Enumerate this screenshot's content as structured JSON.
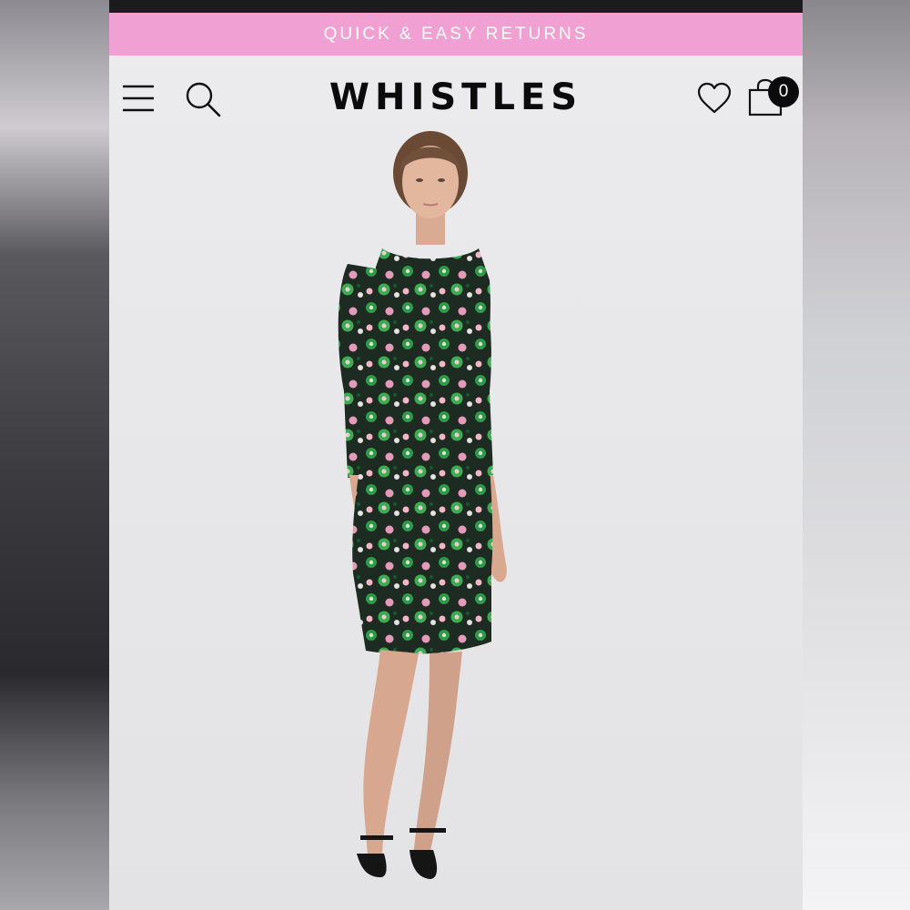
{
  "promo": {
    "text": "QUICK & EASY RETURNS"
  },
  "header": {
    "brand": "WHISTLES",
    "menu_icon": "hamburger-menu-icon",
    "search_icon": "search-icon",
    "wishlist_icon": "heart-icon",
    "bag_icon": "shopping-bag-icon",
    "bag_count": "0"
  },
  "colors": {
    "banner": "#f1a0d3",
    "status_bar": "#1b1b1d",
    "brand_text": "#0b0b0b",
    "page_background": "#e8e8ea",
    "dress_base": "#1d2b22",
    "print_green": "#2e9a48",
    "print_pink": "#e59ab8"
  },
  "product": {
    "image": "model wearing floral-print long-sleeve dress"
  }
}
